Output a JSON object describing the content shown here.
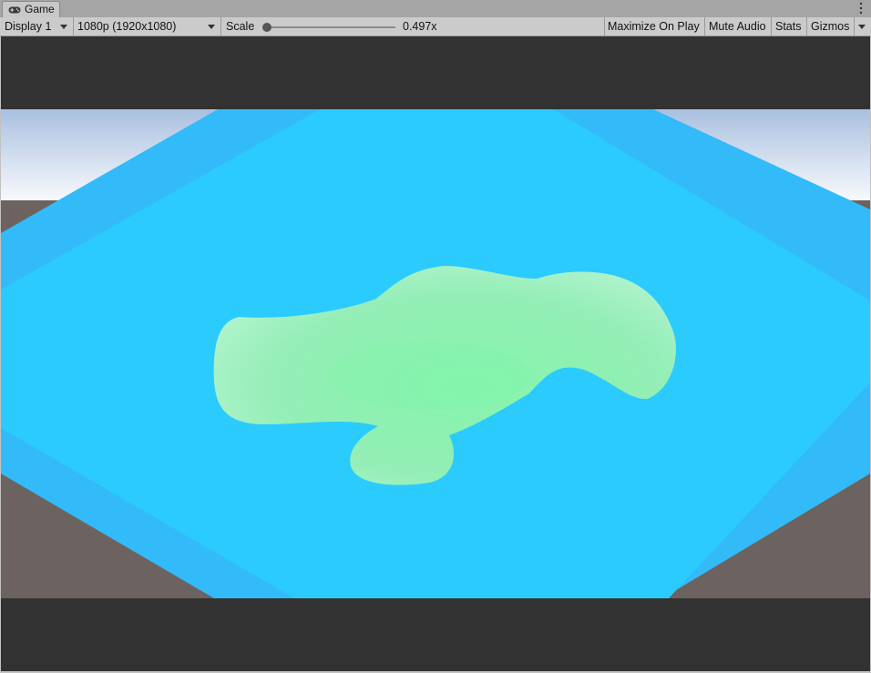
{
  "window": {
    "tab_title": "Game"
  },
  "icons": {
    "tab_icon": "gamepad-icon",
    "menu": "kebab-menu-icon",
    "dropdown": "chevron-down-icon"
  },
  "toolbar": {
    "display": "Display 1",
    "resolution": "1080p (1920x1080)",
    "scale_label": "Scale",
    "scale_value": "0.497x",
    "scale_fraction": 0.0,
    "maximize_on_play": "Maximize On Play",
    "mute_audio": "Mute Audio",
    "stats": "Stats",
    "gizmos": "Gizmos"
  },
  "colors": {
    "sky_top": "#a9c0e0",
    "sky_bottom": "#ffffff",
    "ground": "#6c6360",
    "platform_border": "#33baf8",
    "platform_inner": "#2bcbfe",
    "slime": "#8ef0b0",
    "letterbox": "#323232"
  }
}
